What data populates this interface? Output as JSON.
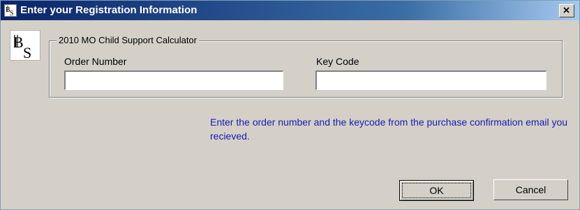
{
  "window": {
    "title": "Enter your Registration Information",
    "title_icon": "bs-logo-icon",
    "close_icon": "close-icon"
  },
  "logo": {
    "icon": "bs-logo-icon"
  },
  "group": {
    "legend": "2010 MO Child Support Calculator",
    "order_number_label": "Order Number",
    "order_number_value": "",
    "key_code_label": "Key Code",
    "key_code_value": ""
  },
  "info_message": "Enter the order number and the keycode from the purchase confirmation email you recieved.",
  "buttons": {
    "ok_label": "OK",
    "cancel_label": "Cancel"
  },
  "colors": {
    "title_gradient_start": "#0a246a",
    "title_gradient_end": "#a6caf0",
    "dialog_face": "#d4d0c8",
    "info_text": "#1a1ab5"
  }
}
